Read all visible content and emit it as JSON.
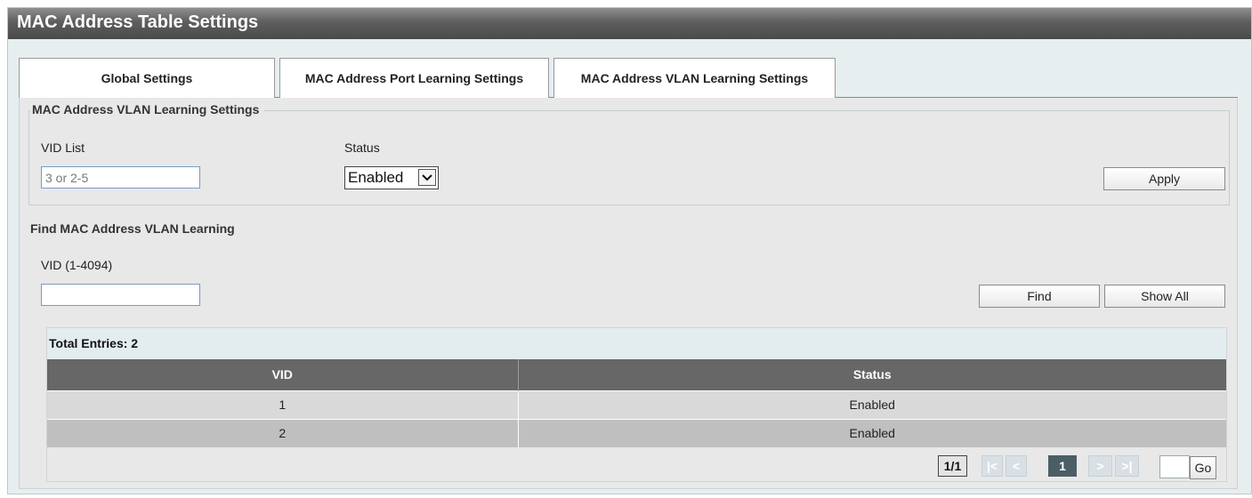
{
  "title": "MAC Address Table Settings",
  "tabs": [
    {
      "label": "Global Settings"
    },
    {
      "label": "MAC Address Port Learning Settings"
    },
    {
      "label": "MAC Address VLAN Learning Settings"
    }
  ],
  "active_tab": "MAC Address VLAN Learning Settings",
  "vlan_learning": {
    "legend": "MAC Address VLAN Learning Settings",
    "vid_list_label": "VID List",
    "vid_list_placeholder": "3 or 2-5",
    "status_label": "Status",
    "status_value": "Enabled",
    "apply_label": "Apply"
  },
  "find": {
    "heading": "Find MAC Address VLAN Learning",
    "vid_label": "VID (1-4094)",
    "vid_value": "",
    "find_label": "Find",
    "show_all_label": "Show All"
  },
  "table": {
    "total_entries_label": "Total Entries: 2",
    "columns": [
      "VID",
      "Status"
    ],
    "rows": [
      {
        "vid": "1",
        "status": "Enabled"
      },
      {
        "vid": "2",
        "status": "Enabled"
      }
    ]
  },
  "pagination": {
    "page_info": "1/1",
    "first": "|<",
    "prev": "<",
    "current": "1",
    "next": ">",
    "last": ">|",
    "go_label": "Go"
  }
}
